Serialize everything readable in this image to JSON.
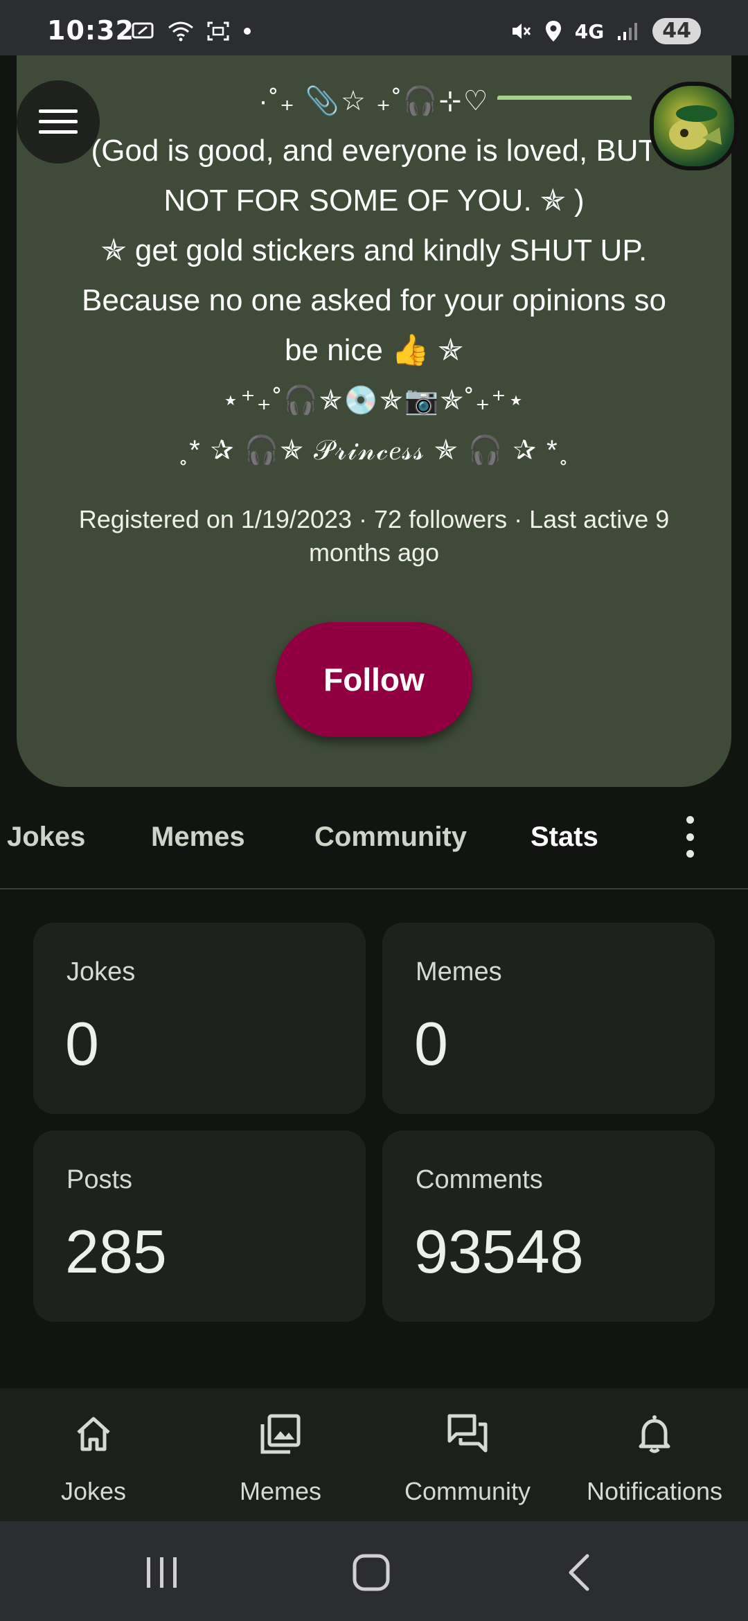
{
  "status_bar": {
    "time": "10:32",
    "network": "4G",
    "battery": "44"
  },
  "profile": {
    "bio_lines": [
      "·˚₊ 📎☆ ₊˚🎧⊹♡",
      "(God is good, and everyone is loved, BUT",
      "NOT FOR SOME OF YOU. ✯ )",
      "✯ get gold stickers and kindly SHUT UP.",
      "Because no one asked for your opinions so",
      "be nice 👍 ✯",
      "⋆⁺₊˚🎧✯💿✯📷✯˚₊⁺⋆",
      "˳* ✰ 🎧✯ 𝒫𝓇𝒾𝓃𝒸𝑒𝓈𝓈 ✯ 🎧 ✰ *˳"
    ],
    "meta": "Registered on 1/19/2023 · 72 followers · Last active 9 months ago",
    "follow_label": "Follow"
  },
  "tabs": [
    {
      "label": "Jokes",
      "active": false
    },
    {
      "label": "Memes",
      "active": false
    },
    {
      "label": "Community",
      "active": false
    },
    {
      "label": "Stats",
      "active": true
    }
  ],
  "stats": [
    {
      "label": "Jokes",
      "value": "0"
    },
    {
      "label": "Memes",
      "value": "0"
    },
    {
      "label": "Posts",
      "value": "285"
    },
    {
      "label": "Comments",
      "value": "93548"
    }
  ],
  "bottom_nav": [
    {
      "label": "Jokes",
      "icon": "home-icon"
    },
    {
      "label": "Memes",
      "icon": "image-gallery-icon"
    },
    {
      "label": "Community",
      "icon": "forum-icon"
    },
    {
      "label": "Notifications",
      "icon": "bell-icon"
    }
  ],
  "colors": {
    "accent": "#900040",
    "card": "#3f4b38",
    "indicator": "#a6d18c"
  }
}
